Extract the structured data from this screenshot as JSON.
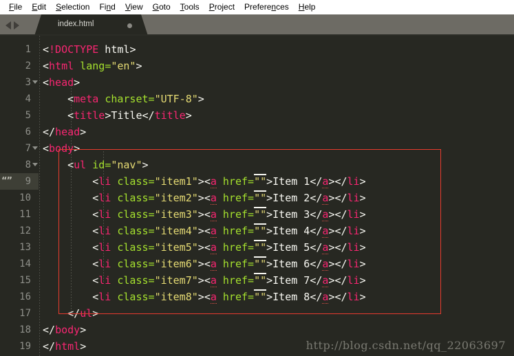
{
  "menubar": {
    "items": [
      {
        "label": "File",
        "accel": "F"
      },
      {
        "label": "Edit",
        "accel": "E"
      },
      {
        "label": "Selection",
        "accel": "S"
      },
      {
        "label": "Find",
        "accel": "n"
      },
      {
        "label": "View",
        "accel": "V"
      },
      {
        "label": "Goto",
        "accel": "G"
      },
      {
        "label": "Tools",
        "accel": "T"
      },
      {
        "label": "Project",
        "accel": "P"
      },
      {
        "label": "Preferences",
        "accel": "n"
      },
      {
        "label": "Help",
        "accel": "H"
      }
    ]
  },
  "tabbar": {
    "prev_icon": "arrow-left-icon",
    "next_icon": "arrow-right-icon",
    "tabs": [
      {
        "label": "index.html",
        "dirty": true,
        "active": true
      }
    ]
  },
  "editor": {
    "language": "HTML",
    "theme_background": "#272822",
    "colors": {
      "tag": "#f92672",
      "attribute": "#a6e22e",
      "string": "#e6db74",
      "text": "#f8f8f2",
      "linenumber": "#8f908a",
      "annotation": "#e83b2e"
    },
    "lines": [
      {
        "n": "1",
        "fold": false,
        "bookmark": false,
        "text": "<!DOCTYPE html>"
      },
      {
        "n": "2",
        "fold": false,
        "bookmark": false,
        "text": "<html lang=\"en\">"
      },
      {
        "n": "3",
        "fold": true,
        "bookmark": false,
        "text": "<head>"
      },
      {
        "n": "4",
        "fold": false,
        "bookmark": false,
        "text": "    <meta charset=\"UTF-8\">"
      },
      {
        "n": "5",
        "fold": false,
        "bookmark": false,
        "text": "    <title>Title</title>"
      },
      {
        "n": "6",
        "fold": false,
        "bookmark": false,
        "text": "</head>"
      },
      {
        "n": "7",
        "fold": true,
        "bookmark": false,
        "text": "<body>"
      },
      {
        "n": "8",
        "fold": true,
        "bookmark": false,
        "text": "    <ul id=\"nav\">"
      },
      {
        "n": "9",
        "fold": false,
        "bookmark": true,
        "text": "        <li class=\"item1\"><a href=\"\">Item 1</a></li>"
      },
      {
        "n": "10",
        "fold": false,
        "bookmark": false,
        "text": "        <li class=\"item2\"><a href=\"\">Item 2</a></li>"
      },
      {
        "n": "11",
        "fold": false,
        "bookmark": false,
        "text": "        <li class=\"item3\"><a href=\"\">Item 3</a></li>"
      },
      {
        "n": "12",
        "fold": false,
        "bookmark": false,
        "text": "        <li class=\"item4\"><a href=\"\">Item 4</a></li>"
      },
      {
        "n": "13",
        "fold": false,
        "bookmark": false,
        "text": "        <li class=\"item5\"><a href=\"\">Item 5</a></li>"
      },
      {
        "n": "14",
        "fold": false,
        "bookmark": false,
        "text": "        <li class=\"item6\"><a href=\"\">Item 6</a></li>"
      },
      {
        "n": "15",
        "fold": false,
        "bookmark": false,
        "text": "        <li class=\"item7\"><a href=\"\">Item 7</a></li>"
      },
      {
        "n": "16",
        "fold": false,
        "bookmark": false,
        "text": "        <li class=\"item8\"><a href=\"\">Item 8</a></li>"
      },
      {
        "n": "17",
        "fold": false,
        "bookmark": false,
        "text": "    </ul>"
      },
      {
        "n": "18",
        "fold": false,
        "bookmark": false,
        "text": "</body>"
      },
      {
        "n": "19",
        "fold": false,
        "bookmark": false,
        "text": "</html>"
      }
    ],
    "highlighted_line": "9",
    "bookmark_glyph": "“”",
    "annotation_rect": {
      "from_line": "8",
      "to_line": "17"
    }
  },
  "watermark": {
    "text": "http://blog.csdn.net/qq_22063697"
  }
}
